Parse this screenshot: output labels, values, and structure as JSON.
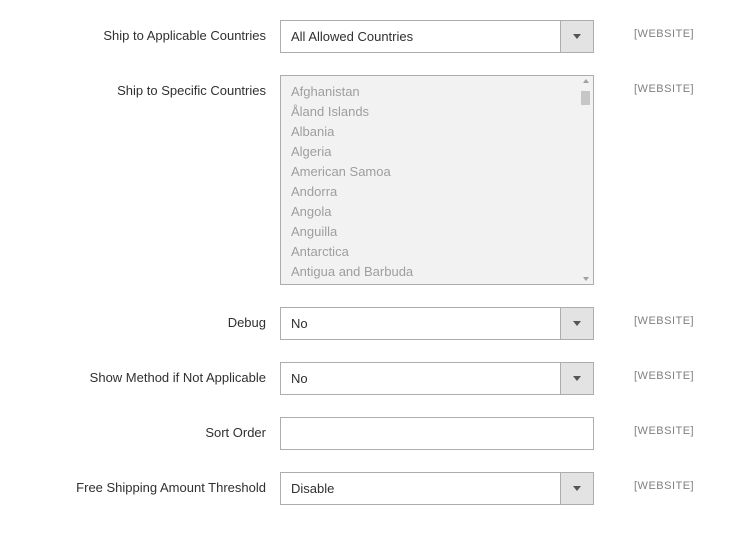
{
  "scope_label": "[WEBSITE]",
  "fields": {
    "ship_applicable": {
      "label": "Ship to Applicable Countries",
      "value": "All Allowed Countries"
    },
    "ship_specific": {
      "label": "Ship to Specific Countries",
      "options": [
        "Afghanistan",
        "Åland Islands",
        "Albania",
        "Algeria",
        "American Samoa",
        "Andorra",
        "Angola",
        "Anguilla",
        "Antarctica",
        "Antigua and Barbuda"
      ]
    },
    "debug": {
      "label": "Debug",
      "value": "No"
    },
    "show_method": {
      "label": "Show Method if Not Applicable",
      "value": "No"
    },
    "sort_order": {
      "label": "Sort Order",
      "value": ""
    },
    "free_shipping_threshold": {
      "label": "Free Shipping Amount Threshold",
      "value": "Disable"
    }
  }
}
